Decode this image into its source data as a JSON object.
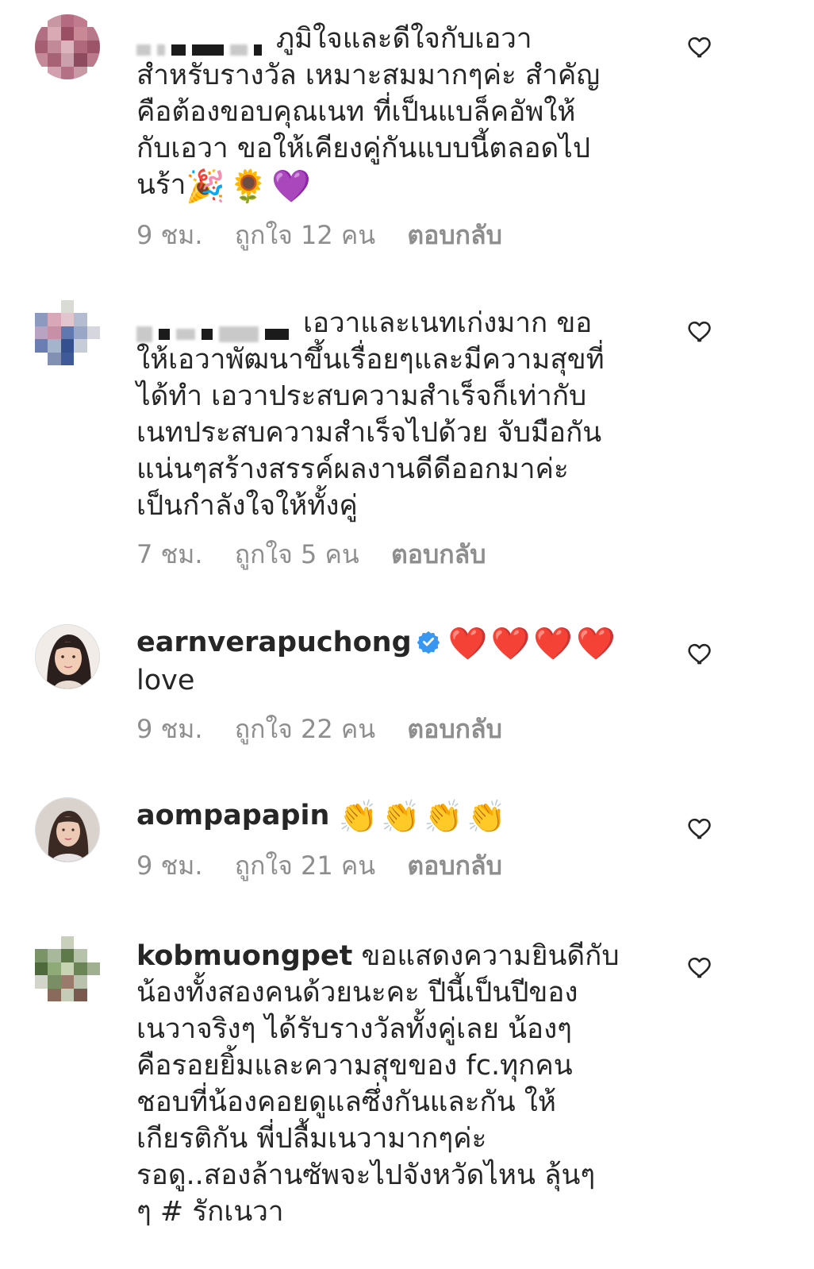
{
  "comments": [
    {
      "username": "",
      "text_lines": [
        "ภูมิใจและดีใจกับเอวา",
        "สำหรับรางวัล เหมาะสมมากๆค่ะ สำคัญ",
        "คือต้องขอบคุณเนท ที่เป็นแบล็คอัพให้",
        "กับเอวา ขอให้เคียงคู่กันแบบนี้ตลอดไป",
        "นร้า"
      ],
      "emojis": [
        "🎉",
        "🌻",
        "💜"
      ],
      "time": "9 ชม.",
      "likes": "ถูกใจ 12 คน",
      "reply": "ตอบกลับ",
      "avatar_colors": [
        "#c08a98",
        "#b66a7e",
        "#d8a0ae",
        "#9e5a6c",
        "#c47c90"
      ]
    },
    {
      "username": "",
      "text_lines": [
        "เอวาและเนทเก่งมาก ขอ",
        "ให้เอวาพัฒนาขึ้นเรื่อยๆและมีความสุขที่",
        "ได้ทำ เอวาประสบความสำเร็จก็เท่ากับ",
        "เนทประสบความสำเร็จไปด้วย จับมือกัน",
        "แน่นๆสร้างสรรค์ผลงานดีดีออกมาค่ะ",
        "เป็นกำลังใจให้ทั้งคู่"
      ],
      "time": "7 ชม.",
      "likes": "ถูกใจ 5 คน",
      "reply": "ตอบกลับ",
      "avatar_colors": [
        "#7f8fb5",
        "#c49aa8",
        "#3f5a9a",
        "#a8b0c8",
        "#d6c6cc"
      ]
    },
    {
      "username": "earnverapuchong",
      "text_lines": [
        "love"
      ],
      "emojis": [
        "❤️",
        "❤️",
        "❤️",
        "❤️"
      ],
      "time": "9 ชม.",
      "likes": "ถูกใจ 22 คน",
      "reply": "ตอบกลับ",
      "verified": true
    },
    {
      "username": "aompapapin",
      "emojis": [
        "👏",
        "👏",
        "👏",
        "👏"
      ],
      "time": "9 ชม.",
      "likes": "ถูกใจ 21 คน",
      "reply": "ตอบกลับ"
    },
    {
      "username": "kobmuongpet",
      "text_lines": [
        "ขอแสดงความยินดีกับ",
        "น้องทั้งสองคนด้วยนะคะ ปีนี้เป็นปีของ",
        "เนวาจริงๆ ได้รับรางวัลทั้งคู่เลย น้องๆ",
        "คือรอยยิ้มและความสุขของ fc.ทุกคน",
        "ชอบที่น้องคอยดูแลซึ่งกันและกัน ให้",
        "เกียรติกัน พี่ปลื้มเนวามากๆค่ะ",
        "รอดู..สองล้านซัพจะไปจังหวัดไหน ลุ้นๆ",
        "ๆ # รักเนวา"
      ],
      "avatar_colors": [
        "#6e8a5a",
        "#a9b89a",
        "#4e6a3c",
        "#c8d0c0",
        "#8a6a5a"
      ]
    }
  ],
  "colors": {
    "text": "#262626",
    "meta": "#8e8e8e",
    "verified": "#3897f0"
  }
}
